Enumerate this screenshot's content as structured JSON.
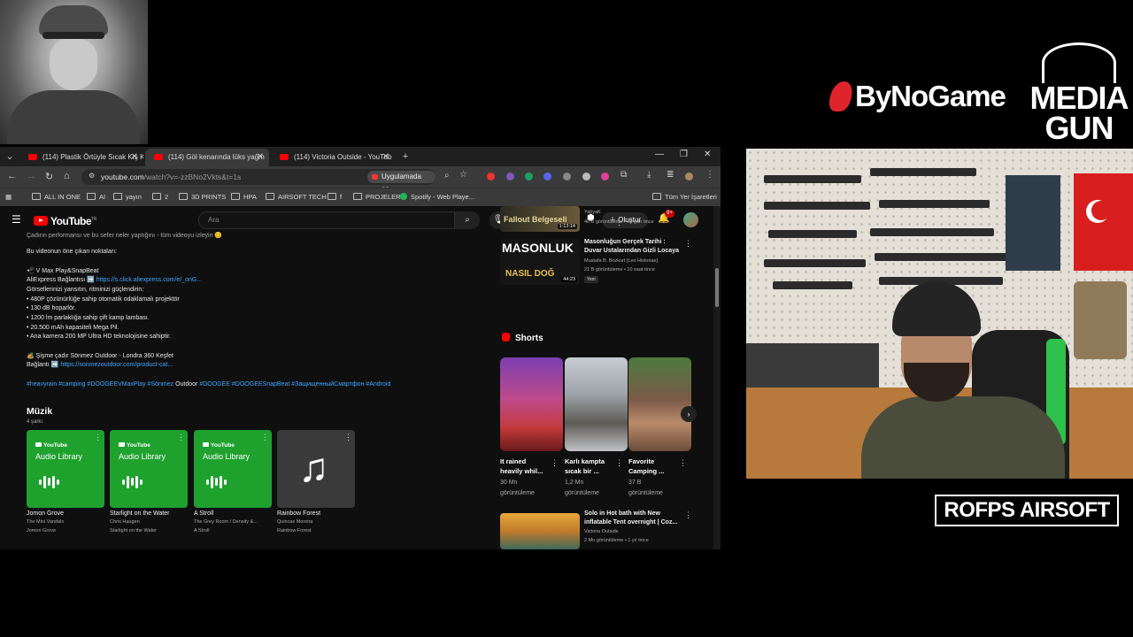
{
  "overlay": {
    "bynogame": "ByNoGame",
    "mediagun_line1": "MEDIA",
    "mediagun_line2": "GUN",
    "rofps": "ROFPS AIRSOFT"
  },
  "tabs": [
    {
      "title": "(114) Plastik Örtüyle Sıcak Kış K",
      "active": false
    },
    {
      "title": "(114) Göl kenarında lüks yağm",
      "active": true
    },
    {
      "title": "(114) Victoria Outside - YouTub",
      "active": false
    }
  ],
  "browser": {
    "url_host": "youtube.com",
    "url_path": "/watch?v=-zzBNo2Vkts&t=1s",
    "open_in_app": "Uygulamada aç"
  },
  "bookmarks": [
    "ALL IN ONE",
    "AI",
    "yayın",
    "2",
    "3D PRINTS",
    "HPA",
    "AIRSOFT TECH",
    "f",
    "PROJELER",
    "Spotify - Web Playe...",
    "Tüm Yer İşaretleri"
  ],
  "youtube": {
    "logo": "YouTube",
    "logo_region": "TR",
    "search_placeholder": "Ara",
    "create_label": "Oluştur",
    "notif_count": "9+"
  },
  "description": {
    "cut_line": "Çadırın performansı ve bu sefer neler yaptığını - tüm videoyu izleyin 😊",
    "highlights_heading": "Bu videonun öne çıkan noktaları:",
    "product": "📲 V Max Play&SnapBeat",
    "ali_label": "AliExpress Bağlantısı ➡️",
    "ali_link": "https://s.click.aliexpress.com/e/_onG...",
    "line_a": "Görsellerinizi yansıtın, ritminizi güçlendirin:",
    "bullets": [
      "• 480P çözünürlüğe sahip otomatik odaklamalı projektör",
      "• 130 dB hoparlör.",
      "• 1200 lm parlaklığa sahip çift kamp lambası.",
      "• 20.500 mAh kapasiteli Mega Pil.",
      "• Ana kamera 200 MP Ultra HD teknolojisine sahiptir."
    ],
    "tent": "🏕️ Şişme çadır Sönmez Outdoor - Londra 360 Keşfet",
    "tent_label": "Bağlantı ➡️",
    "tent_link": "https://sonmezoutdoor.com/product-cat...",
    "tags_a": "#heavyrain #camping #DOOGEEVMaxPlay #Sönmez",
    "tags_b": "Outdoor",
    "tags_c": "#DOOGEE #DOOGEESnapBeat #ЗащищенныйСмартфон #Android"
  },
  "music": {
    "heading": "Müzik",
    "count": "4 şarkı",
    "tracks": [
      {
        "title": "Jomon Grove",
        "artist": "The Mini Vandals",
        "album": "Jomon Grove",
        "art_brand": "YouTube",
        "art_text": "Audio Library"
      },
      {
        "title": "Starlight on the Water",
        "artist": "Chris Haugen",
        "album": "Starlight on the Water",
        "art_brand": "YouTube",
        "art_text": "Audio Library"
      },
      {
        "title": "A Stroll",
        "artist": "The Grey Room / Density &...",
        "album": "A Stroll",
        "art_brand": "YouTube",
        "art_text": "Audio Library"
      },
      {
        "title": "Rainbow Forest",
        "artist": "Quincas Moreira",
        "album": "Rainbow Forest"
      }
    ]
  },
  "related": [
    {
      "title": "",
      "channel": "YahyaK",
      "meta": "48 B görüntüleme • 10 gün önce",
      "duration": "1:13:14",
      "thumb_text": "Fallout Belgeseli"
    },
    {
      "title": "Masonluğun Gerçek Tarihi : Duvar Ustalarından Gizli Locaya",
      "channel": "Mustafa B. Bozkurt [Lex Historiae]",
      "meta": "21 B görüntüleme • 10 saat önce",
      "duration": "44:23",
      "badge": "Yeni",
      "thumb_text": "MASONLUK",
      "thumb_text2": "NASIL DOĞ"
    },
    {
      "title": "Solo in Hot bath with New inflatable Tent overnight | Coz...",
      "channel": "Victoria Outside",
      "meta": "2 Mn görüntüleme • 1 yıl önce"
    }
  ],
  "shorts": {
    "heading": "Shorts",
    "items": [
      {
        "title1": "It rained",
        "title2": "heavily whil...",
        "views1": "30 Mn",
        "views2": "görüntüleme"
      },
      {
        "title1": "Karlı kampta",
        "title2": "sıcak bir ...",
        "views1": "1,2 Mn",
        "views2": "görüntüleme"
      },
      {
        "title1": "Favorite",
        "title2": "Camping ...",
        "views1": "37 B",
        "views2": "görüntüleme"
      }
    ]
  }
}
